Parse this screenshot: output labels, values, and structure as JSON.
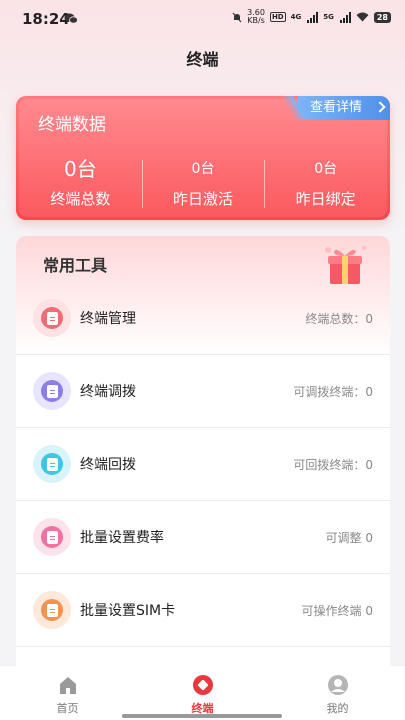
{
  "status_bar": {
    "time": "18:24",
    "net_speed_value": "3.60",
    "net_speed_unit": "KB/s",
    "hd": "HD",
    "signal_1": "4G",
    "signal_2": "5G",
    "battery": "28"
  },
  "header": {
    "title": "终端"
  },
  "stats": {
    "title": "终端数据",
    "detail_link": "查看详情",
    "items": [
      {
        "value": "0台",
        "label": "终端总数"
      },
      {
        "value": "0台",
        "label": "昨日激活"
      },
      {
        "value": "0台",
        "label": "昨日绑定"
      }
    ]
  },
  "tools": {
    "title": "常用工具",
    "items": [
      {
        "label": "终端管理",
        "value": "终端总数：0",
        "icon": "terminal-manage-icon",
        "color": "#f06b74",
        "bg": "#fde1e3"
      },
      {
        "label": "终端调拨",
        "value": "可调拨终端：0",
        "icon": "terminal-transfer-icon",
        "color": "#8a7fe8",
        "bg": "#e8e4fb"
      },
      {
        "label": "终端回拨",
        "value": "可回拨终端：0",
        "icon": "terminal-return-icon",
        "color": "#3fc6e6",
        "bg": "#d9f3fa"
      },
      {
        "label": "批量设置费率",
        "value": "可调整 0",
        "icon": "rate-setting-icon",
        "color": "#f0739f",
        "bg": "#fde2ec"
      },
      {
        "label": "批量设置SIM卡",
        "value": "可操作终端 0",
        "icon": "sim-card-icon",
        "color": "#f39352",
        "bg": "#fde8d9"
      }
    ]
  },
  "tab_bar": {
    "items": [
      {
        "label": "首页",
        "icon": "home-icon"
      },
      {
        "label": "终端",
        "icon": "terminal-icon"
      },
      {
        "label": "我的",
        "icon": "profile-icon"
      }
    ],
    "active_index": 1,
    "active_color": "#e8393f"
  }
}
